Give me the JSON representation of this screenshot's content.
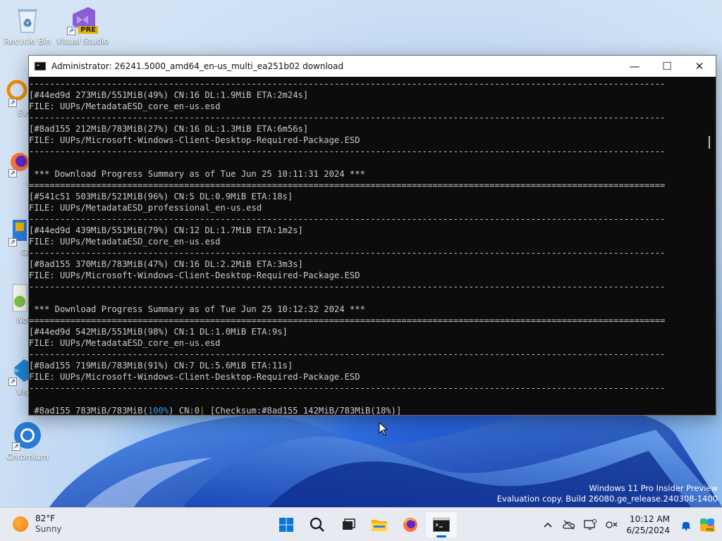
{
  "desktop": {
    "icons": [
      {
        "label": "Recycle Bin"
      },
      {
        "label": "Visual Studio",
        "badge": "PRE"
      },
      {
        "label": "Every"
      },
      {
        "label": "Fire"
      },
      {
        "label": "Git B"
      },
      {
        "label": "Notep"
      },
      {
        "label": "Visual"
      },
      {
        "label": "Co"
      },
      {
        "label": "Chromium"
      }
    ],
    "watermark": {
      "line1": "Windows 11 Pro Insider Preview",
      "line2": "Evaluation copy. Build 26080.ge_release.240308-1400"
    }
  },
  "window": {
    "title": "Administrator:  26241.5000_amd64_en-us_multi_ea251b02 download",
    "minimize": "—",
    "maximize": "☐",
    "close": "✕"
  },
  "console": {
    "lines": [
      "---------------------------------------------------------------------------------------------------------------------------",
      "[#44ed9d 273MiB/551MiB(49%) CN:16 DL:1.9MiB ETA:2m24s]",
      "FILE: UUPs/MetadataESD_core_en-us.esd",
      "---------------------------------------------------------------------------------------------------------------------------",
      "[#8ad155 212MiB/783MiB(27%) CN:16 DL:1.3MiB ETA:6m56s]",
      "FILE: UUPs/Microsoft-Windows-Client-Desktop-Required-Package.ESD",
      "---------------------------------------------------------------------------------------------------------------------------",
      "",
      " *** Download Progress Summary as of Tue Jun 25 10:11:31 2024 ***",
      "===========================================================================================================================",
      "[#541c51 503MiB/521MiB(96%) CN:5 DL:0.9MiB ETA:18s]",
      "FILE: UUPs/MetadataESD_professional_en-us.esd",
      "---------------------------------------------------------------------------------------------------------------------------",
      "[#44ed9d 439MiB/551MiB(79%) CN:12 DL:1.7MiB ETA:1m2s]",
      "FILE: UUPs/MetadataESD_core_en-us.esd",
      "---------------------------------------------------------------------------------------------------------------------------",
      "[#8ad155 370MiB/783MiB(47%) CN:16 DL:2.2MiB ETA:3m3s]",
      "FILE: UUPs/Microsoft-Windows-Client-Desktop-Required-Package.ESD",
      "---------------------------------------------------------------------------------------------------------------------------",
      "",
      " *** Download Progress Summary as of Tue Jun 25 10:12:32 2024 ***",
      "===========================================================================================================================",
      "[#44ed9d 542MiB/551MiB(98%) CN:1 DL:1.0MiB ETA:9s]",
      "FILE: UUPs/MetadataESD_core_en-us.esd",
      "---------------------------------------------------------------------------------------------------------------------------",
      "[#8ad155 719MiB/783MiB(91%) CN:7 DL:5.6MiB ETA:11s]",
      "FILE: UUPs/Microsoft-Windows-Client-Desktop-Required-Package.ESD",
      "---------------------------------------------------------------------------------------------------------------------------",
      ""
    ],
    "status_line": {
      "part1": " #8ad155 783MiB/783MiB(",
      "pct": "100%",
      "part2": ") CN:0",
      "sep": "|",
      "part3": " [Checksum:#8ad155 142MiB/783MiB(18%)]"
    }
  },
  "taskbar": {
    "weather": {
      "temp": "82°F",
      "condition": "Sunny"
    },
    "apps": [
      {
        "icon": "start-icon"
      },
      {
        "icon": "search-icon"
      },
      {
        "icon": "task-view-icon"
      },
      {
        "icon": "file-explorer-icon"
      },
      {
        "icon": "firefox-icon"
      },
      {
        "icon": "terminal-icon",
        "active": true
      }
    ],
    "clock": {
      "time": "10:12 AM",
      "date": "6/25/2024"
    }
  },
  "colors": {
    "console_bg": "#0c0c0c",
    "console_text": "#cccccc",
    "accent": "#0067c0",
    "highlight_blue": "#3a96dd"
  }
}
